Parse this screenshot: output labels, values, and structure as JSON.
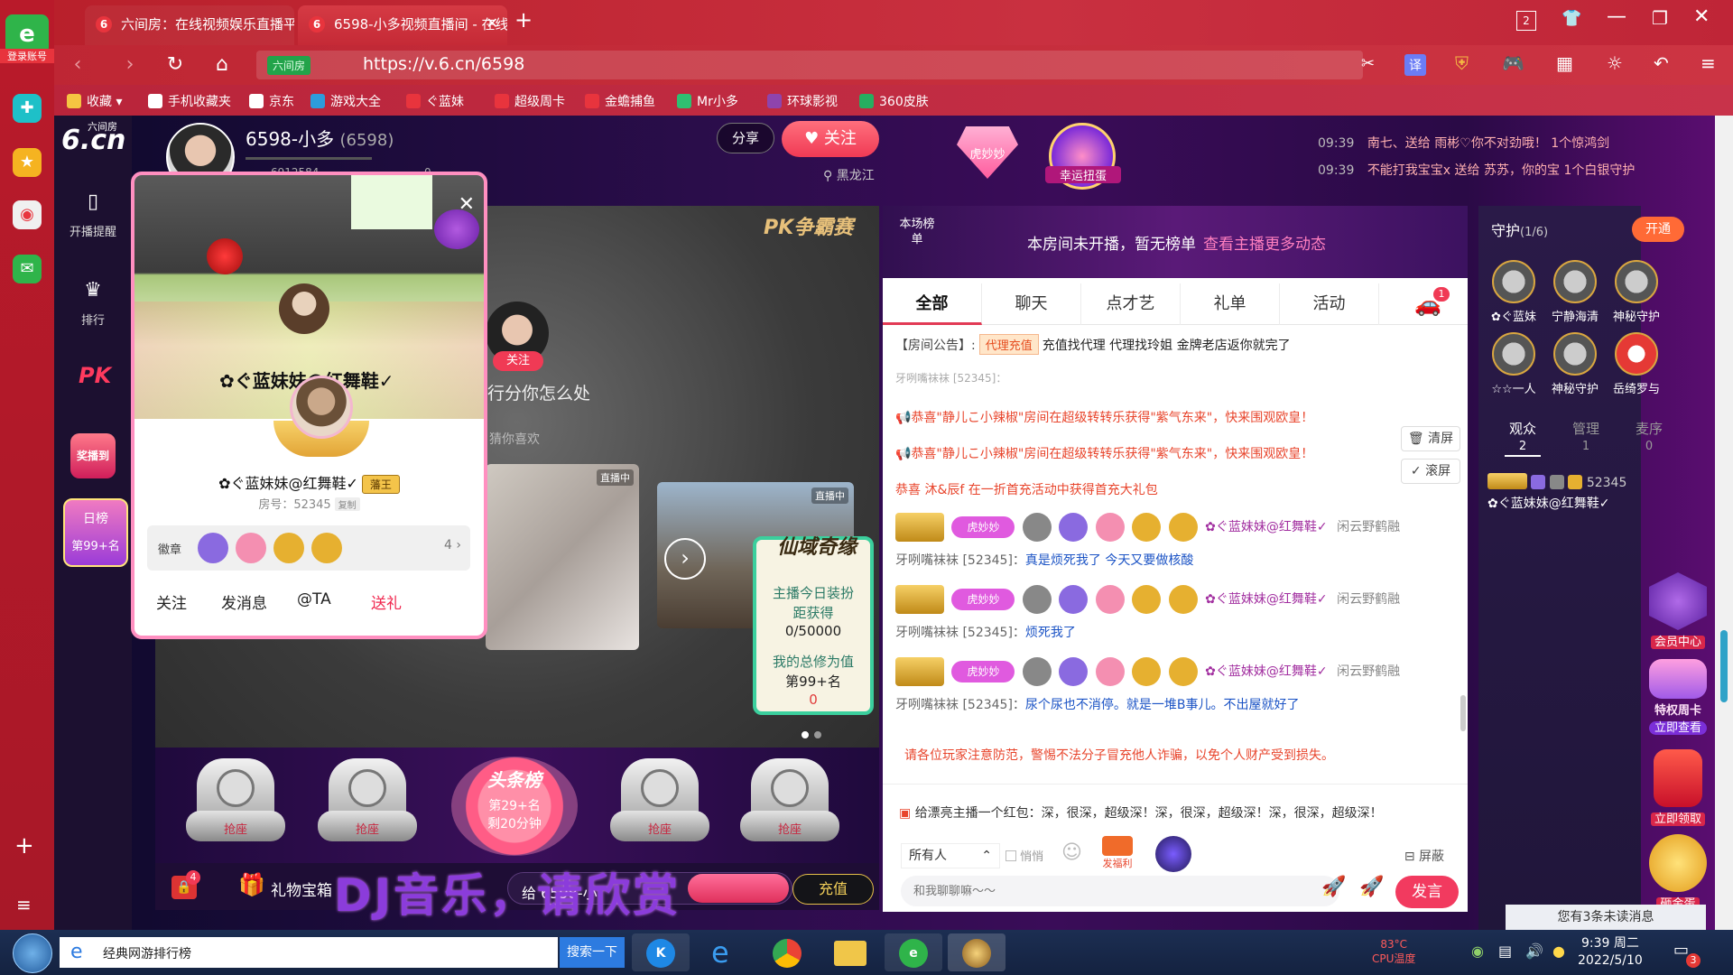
{
  "browser": {
    "tabs": [
      {
        "label": "六间房：在线视频娱乐直播平",
        "active": false
      },
      {
        "label": "6598-小多视频直播间 - 在线视",
        "active": true
      }
    ],
    "sidebar_label": "登录账号",
    "url": "https://v.6.cn/6598",
    "url_badge": "六间房",
    "window_controls": [
      "2"
    ],
    "translate_label": "译"
  },
  "bookmarks": [
    {
      "label": "收藏",
      "color": "#f5c542"
    },
    {
      "label": "手机收藏夹",
      "color": "#ffffff"
    },
    {
      "label": "京东",
      "color": "#ffffff"
    },
    {
      "label": "游戏大全",
      "color": "#2d9cdb"
    },
    {
      "label": "ぐ蓝妹",
      "color": "#e8343d"
    },
    {
      "label": "超级周卡",
      "color": "#e8343d"
    },
    {
      "label": "金蟾捕鱼",
      "color": "#e8343d"
    },
    {
      "label": "Mr小多",
      "color": "#2fbf71"
    },
    {
      "label": "环球影视",
      "color": "#8e44ad"
    },
    {
      "label": "360皮肤",
      "color": "#27ae60"
    }
  ],
  "site_nav": {
    "logo_top": "六间房",
    "logo": "6.cn",
    "items": [
      "开播提醒",
      "排行",
      "PK",
      "奖播到"
    ]
  },
  "streamer": {
    "name": "6598-小多",
    "id": "(6598)",
    "share": "分享",
    "follow": "关注",
    "location": "黑龙江",
    "stats": "6912584",
    "fans": "0"
  },
  "top_badges": {
    "tiger": "虎妙妙",
    "lucky": "幸运扭蛋"
  },
  "ticker": [
    {
      "time": "09:39",
      "text": "南七、送给 雨彬♡你不对劲哦！ 1个惊鸿剑"
    },
    {
      "time": "09:39",
      "text": "不能打我宝宝x 送给 苏苏，你的宝 1个白银守护"
    }
  ],
  "video": {
    "pk_logo": "PK争霸赛",
    "ghost_follow": "关注",
    "ghost_text": "行分你怎么处",
    "guess_label": "猜你喜欢",
    "live_badge": "直播中",
    "live_badge2": "直播中"
  },
  "xian_card": {
    "title": "仙域奇缘",
    "line1": "主播今日装扮",
    "line2": "距获得",
    "progress": "0/50000",
    "line3": "我的总修为值",
    "rank": "第99+名",
    "value": "0"
  },
  "seats": [
    {
      "label": "抢座"
    },
    {
      "label": "抢座"
    },
    {
      "label": "抢座"
    },
    {
      "label": "抢座"
    }
  ],
  "headline": {
    "title": "头条榜",
    "rank": "第29+名",
    "time": "剩20分钟"
  },
  "giftbar": {
    "count": "4",
    "giftbox": "礼物宝箱",
    "dj": "DJ音乐，请欣赏",
    "sendto": "给  6598-小",
    "recharge": "充值"
  },
  "popup": {
    "name_banner": "✿ぐ蓝妹妹@红舞鞋✓",
    "name": "✿ぐ蓝妹妹@红舞鞋✓",
    "king": "藩王",
    "room_label": "房号：52345",
    "copy": "复制",
    "medals_label": "徽章",
    "medals_more": "4 ›",
    "medal_colors": [
      "#8a6ae0",
      "#f48fb1",
      "#e6b030",
      "#e6b030"
    ],
    "actions": [
      "关注",
      "发消息",
      "@TA",
      "送礼"
    ]
  },
  "rank_badge": {
    "title": "日榜",
    "rank": "第99+名"
  },
  "board": {
    "this_board": "本场榜单",
    "not_live": "本房间未开播，暂无榜单",
    "link": "查看主播更多动态"
  },
  "chat_tabs": [
    "全部",
    "聊天",
    "点才艺",
    "礼单",
    "活动"
  ],
  "car_badge": "1",
  "chat": {
    "notice_label": "【房间公告】:",
    "notice_tag": "代理充值",
    "notice_text": "充值找代理 代理找玲姐 金牌老店返你就完了",
    "cut_user": "牙咧嘴袜袜 [52345]：",
    "sys1": "恭喜\"静儿こ小辣椒\"房间在超级转转乐获得\"紫气东来\"，快来围观欧皇！",
    "sys2": "恭喜\"静儿こ小辣椒\"房间在超级转转乐获得\"紫气东来\"，快来围观欧皇！",
    "sys3": "恭喜 沐&辰f 在一折首充活动中获得首充大礼包",
    "clear": "清屏",
    "scroll": "滚屏",
    "user_badge_text": "✿ぐ蓝妹妹@红舞鞋✓",
    "user_tail": "闲云野鹤融",
    "tiger": "虎妙妙",
    "messages": [
      {
        "user": "牙咧嘴袜袜 [52345]：",
        "text": "真是烦死我了 今天又要做核酸"
      },
      {
        "user": "牙咧嘴袜袜 [52345]：",
        "text": "烦死我了"
      },
      {
        "user": "牙咧嘴袜袜 [52345]：",
        "text": "尿个尿也不消停。就是一堆B事儿。不出屋就好了"
      }
    ],
    "warning": "请各位玩家注意防范，警惕不法分子冒充他人诈骗，以免个人财产受到损失。",
    "hongbao": "给漂亮主播一个红包：深，很深，超级深！深，很深，超级深！深，很深，超级深！",
    "audience_select": "所有人",
    "quiet": "悄悄",
    "welfare": "发福利",
    "shield": "屏蔽",
    "placeholder": "和我聊聊嘛～～",
    "send": "发言"
  },
  "guard": {
    "title": "守护",
    "count": "(1/6)",
    "open": "开通",
    "members": [
      "✿ぐ蓝妹",
      "宁静海清",
      "神秘守护",
      "☆☆一人",
      "神秘守护",
      "岳绮罗与"
    ],
    "tabs": [
      {
        "label": "观众",
        "n": "2"
      },
      {
        "label": "管理",
        "n": "1"
      },
      {
        "label": "麦序",
        "n": "0"
      }
    ],
    "audience1_level": "52345",
    "audience1_name": "✿ぐ蓝妹妹@红舞鞋✓"
  },
  "right_icons": [
    "会员中心",
    "特权周卡",
    "立即查看",
    "立即领取",
    "砸金蛋"
  ],
  "unread": "您有3条未读消息",
  "taskbar": {
    "search_text": "经典网游排行榜",
    "search_btn": "搜索一下",
    "cpu_temp": "83°C",
    "cpu_label": "CPU温度",
    "time": "9:39 周二",
    "date": "2022/5/10",
    "notif": "3"
  }
}
